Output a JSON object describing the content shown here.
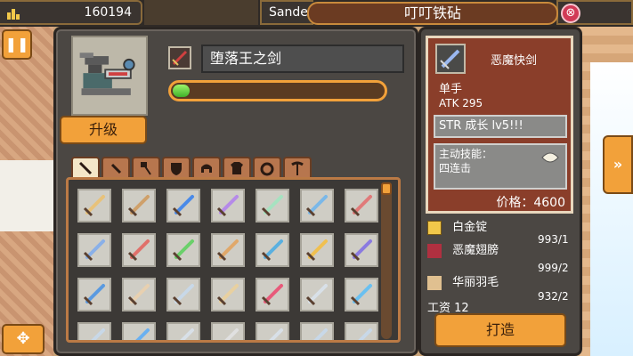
{
  "topbar": {
    "resource_count": "160194",
    "location_text": "Sande",
    "shop_title": "叮叮铁砧",
    "close_glyph": "⊗"
  },
  "controls": {
    "pause_glyph": "❚❚",
    "next_glyph": "»",
    "move_glyph": "✥"
  },
  "forge": {
    "upgrade_label": "升级",
    "weapon_name": "堕落王之剑",
    "progress": 0.08
  },
  "tabs": [
    "sword",
    "dagger",
    "axe",
    "shield",
    "helmet",
    "armor",
    "ring",
    "tool"
  ],
  "grid": {
    "columns": 7,
    "items": [
      {
        "color": "#e8c27a"
      },
      {
        "color": "#cfa06a"
      },
      {
        "color": "#4a8ae8"
      },
      {
        "color": "#b58ae8"
      },
      {
        "color": "#a6e2c0"
      },
      {
        "color": "#7ab8e8"
      },
      {
        "color": "#e07a7a"
      },
      {
        "color": "#8ab0e8"
      },
      {
        "color": "#e0706a"
      },
      {
        "color": "#6ad06a"
      },
      {
        "color": "#e0a86a"
      },
      {
        "color": "#5ab0e0"
      },
      {
        "color": "#f0c050"
      },
      {
        "color": "#8a7ae0"
      },
      {
        "color": "#5a9ae0"
      },
      {
        "color": "#e8d0b0"
      },
      {
        "color": "#c8d8e8"
      },
      {
        "color": "#e8d0a0"
      },
      {
        "color": "#e85a7a"
      },
      {
        "color": "#d8e0e8"
      },
      {
        "color": "#6ac0f0"
      },
      {
        "color": "#c8d8e8"
      },
      {
        "color": "#6ab0f0"
      },
      {
        "color": "#d8e0e8"
      },
      {
        "color": "#e0e0e0"
      },
      {
        "color": "#d8e0e8"
      },
      {
        "color": "#c8d8e8"
      },
      {
        "color": "#c8d8e8"
      }
    ]
  },
  "item_card": {
    "name": "恶魔快剑",
    "hand": "单手",
    "atk": "ATK 295",
    "bonus": "STR 成长 lv5!!!",
    "skill_label": "主动技能：",
    "skill_name": "四连击",
    "price": "价格：4600"
  },
  "materials": [
    {
      "name": "白金锭",
      "count": "",
      "icon_color": "#f2c84a"
    },
    {
      "name": "恶魔翅膀",
      "count": "993/1",
      "icon_color": "#b03040"
    },
    {
      "name": "华丽羽毛",
      "count": "999/2",
      "icon_color": "#e0c090"
    },
    {
      "name": "",
      "count": "932/2",
      "icon_color": ""
    }
  ],
  "wage": "工资 12",
  "forge_button": "打造"
}
